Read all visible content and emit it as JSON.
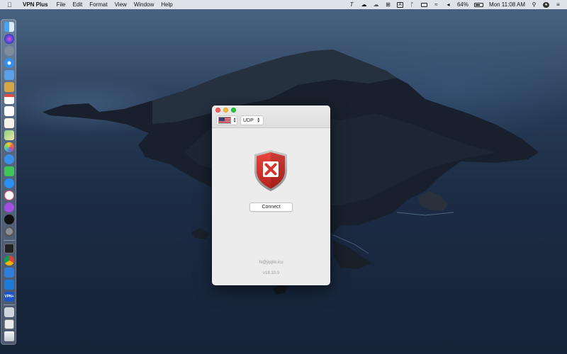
{
  "menubar": {
    "app_name": "VPN Plus",
    "menus": [
      "File",
      "Edit",
      "Format",
      "View",
      "Window",
      "Help"
    ],
    "battery_percent": "64%",
    "clock": "Mon 11:08 AM",
    "status_icons": [
      "text-cursor-icon",
      "cloud-upload-icon",
      "cloud-icon",
      "grid-icon",
      "translate-icon",
      "bluetooth-icon",
      "keyboard-icon",
      "wifi-icon",
      "volume-icon",
      "search-icon",
      "user-icon",
      "control-center-icon"
    ]
  },
  "window": {
    "country_flag": "us-flag-icon",
    "protocol": "UDP",
    "status_icon": "disconnected-shield-icon",
    "connect_label": "Connect",
    "email": "hi@jqqkk.icu",
    "version": "v18.10.0"
  },
  "dock": {
    "apps": [
      "finder-icon",
      "siri-icon",
      "launchpad-icon",
      "safari-icon",
      "mail-icon",
      "notes-icon",
      "calendar-icon",
      "reminders-icon",
      "textedit-icon",
      "maps-icon",
      "photos-icon",
      "messages-icon",
      "facetime-icon",
      "app-store-icon",
      "music-icon",
      "podcasts-icon",
      "tv-icon",
      "system-preferences-icon",
      "terminal-icon",
      "chrome-icon",
      "xcode-icon",
      "vscode-icon",
      "vpn-plus-icon",
      "folder-icon",
      "screenshot-icon",
      "trash-icon"
    ],
    "vpn_label": "VPN+"
  },
  "colors": {
    "shield_red": "#d8322b",
    "menubar_bg": "#ebeef3",
    "window_bg": "#ececec"
  }
}
